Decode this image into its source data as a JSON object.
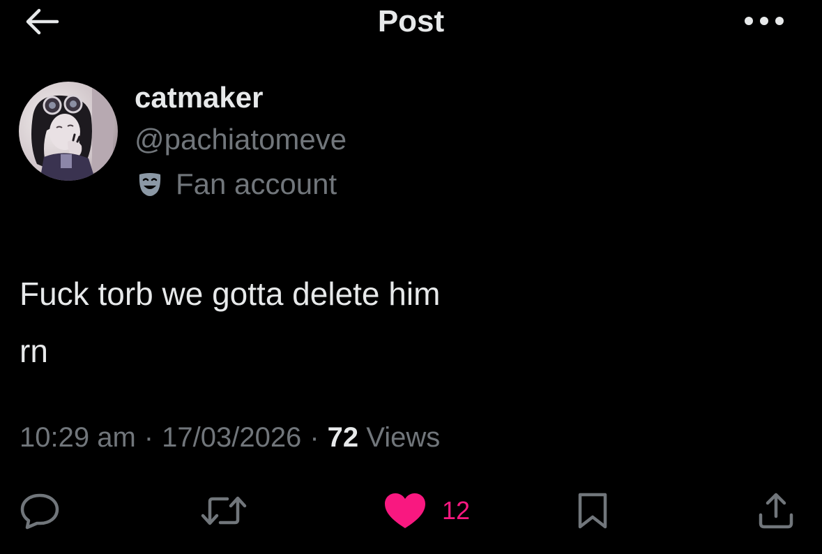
{
  "header": {
    "title": "Post",
    "back_icon": "arrow-left-icon",
    "more_icon": "more-horizontal-icon"
  },
  "author": {
    "display_name": "catmaker",
    "handle": "@pachiatomeve",
    "label": "Fan account",
    "label_icon": "theater-mask-icon",
    "avatar": "profile-avatar"
  },
  "post": {
    "text_line1": "Fuck torb we gotta delete him",
    "text_line2": "rn"
  },
  "meta": {
    "time": "10:29 am",
    "separator": "·",
    "date": "17/03/2026",
    "views_count": "72",
    "views_label": "Views"
  },
  "actions": {
    "reply_icon": "reply-icon",
    "repost_icon": "repost-icon",
    "like_icon": "heart-filled-icon",
    "like_count": "12",
    "bookmark_icon": "bookmark-icon",
    "share_icon": "share-icon"
  },
  "colors": {
    "background": "#000000",
    "primary_text": "#e7e9ea",
    "secondary_text": "#71767b",
    "like_pink": "#f91880"
  }
}
